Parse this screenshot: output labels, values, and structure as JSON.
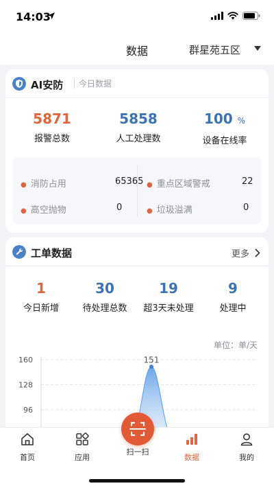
{
  "status_bar": {
    "time": "14:03"
  },
  "header": {
    "title": "数据",
    "community": "群星苑五区"
  },
  "ai_security": {
    "title": "AI安防",
    "subtitle": "今日数据",
    "stats": [
      {
        "value": "5871",
        "label": "报警总数"
      },
      {
        "value": "5858",
        "label": "人工处理数"
      },
      {
        "value": "100",
        "unit": "%",
        "label": "设备在线率"
      }
    ],
    "alarms": [
      {
        "name": "消防占用",
        "value": "65365"
      },
      {
        "name": "重点区域警戒",
        "value": "22"
      },
      {
        "name": "高空抛物",
        "value": "0"
      },
      {
        "name": "垃圾溢满",
        "value": "0"
      }
    ]
  },
  "work_orders": {
    "title": "工单数据",
    "more": "更多",
    "stats": [
      {
        "value": "1",
        "label": "今日新增"
      },
      {
        "value": "30",
        "label": "待处理总数"
      },
      {
        "value": "19",
        "label": "超3天未处理"
      },
      {
        "value": "9",
        "label": "处理中"
      }
    ],
    "unit": "单位：单/天"
  },
  "chart_data": {
    "type": "area",
    "y_ticks": [
      160,
      128,
      96
    ],
    "ylim": [
      96,
      160
    ],
    "peak_label": "151",
    "peak_value": 151
  },
  "tabs": [
    {
      "label": "首页",
      "active": false
    },
    {
      "label": "应用",
      "active": false
    },
    {
      "label": "扫一扫",
      "active": false
    },
    {
      "label": "数据",
      "active": true
    },
    {
      "label": "我的",
      "active": false
    }
  ],
  "colors": {
    "accent": "#e2653e",
    "blue": "#3d72b3"
  }
}
